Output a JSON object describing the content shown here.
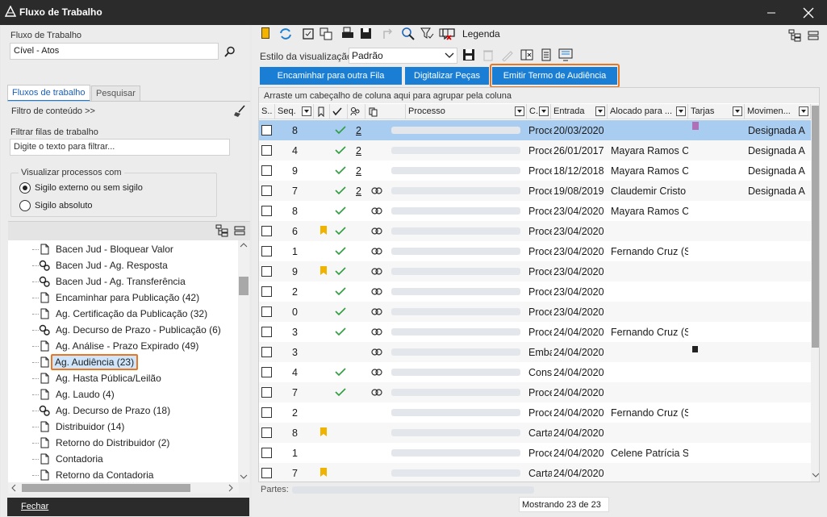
{
  "window": {
    "title": "Fluxo de Trabalho"
  },
  "left": {
    "workflow_label": "Fluxo de Trabalho",
    "workflow_value": "Cível - Atos",
    "tabs": [
      "Fluxos de trabalho",
      "Pesquisar"
    ],
    "content_filter": "Filtro de conteúdo >>",
    "filter_queue_label": "Filtrar filas de trabalho",
    "filter_placeholder": "Digite o texto para filtrar...",
    "visualize_label": "Visualizar processos com",
    "radio_external": "Sigilo externo ou sem sigilo",
    "radio_absolute": "Sigilo absoluto",
    "tree": [
      {
        "label": "Bacen Jud - Bloquear Valor",
        "icon": "doc-icon"
      },
      {
        "label": "Bacen Jud - Ag. Resposta",
        "icon": "gears-icon"
      },
      {
        "label": "Bacen Jud - Ag. Transferência",
        "icon": "gears-icon"
      },
      {
        "label": "Encaminhar para Publicação (42)",
        "icon": "doc-icon"
      },
      {
        "label": "Ag. Certificação da Publicação (32)",
        "icon": "doc-icon"
      },
      {
        "label": "Ag. Decurso de Prazo - Publicação (6)",
        "icon": "gears-icon"
      },
      {
        "label": "Ag. Análise - Prazo Expirado (49)",
        "icon": "doc-icon"
      },
      {
        "label": "Ag. Audiência (23)",
        "icon": "doc-icon"
      },
      {
        "label": "Ag. Hasta Pública/Leilão",
        "icon": "doc-icon"
      },
      {
        "label": "Ag. Laudo (4)",
        "icon": "doc-icon"
      },
      {
        "label": "Ag. Decurso de Prazo (18)",
        "icon": "gears-icon"
      },
      {
        "label": "Distribuidor (14)",
        "icon": "doc-icon"
      },
      {
        "label": "Retorno do Distribuidor (2)",
        "icon": "doc-icon"
      },
      {
        "label": "Contadoria",
        "icon": "doc-icon"
      },
      {
        "label": "Retorno da Contadoria",
        "icon": "doc-icon"
      }
    ],
    "close": "Fechar"
  },
  "toolbar": {
    "legend": "Legenda",
    "view_style_label": "Estilo da visualização",
    "view_style_value": "Padrão"
  },
  "actions": [
    "Encaminhar para outra Fila",
    "Digitalizar Peças",
    "Emitir Termo de Audiência"
  ],
  "grid": {
    "group_hint": "Arraste um cabeçalho de coluna aqui para agrupar pela coluna",
    "columns": [
      "S..",
      "Seq.",
      "",
      "",
      "",
      "",
      "Processo",
      "C..",
      "Entrada",
      "Alocado para ...",
      "Tarjas",
      "Movimen..."
    ],
    "rows": [
      {
        "seq": "8",
        "flag": false,
        "check": true,
        "num": "2",
        "link": false,
        "c": "Proce",
        "entrada": "20/03/2020",
        "alocado": "",
        "tarja": "#b070b8",
        "mov": "Designada A"
      },
      {
        "seq": "4",
        "flag": false,
        "check": true,
        "num": "2",
        "link": false,
        "c": "Proce",
        "entrada": "26/01/2017",
        "alocado": "Mayara Ramos C",
        "tarja": "",
        "mov": "Designada A"
      },
      {
        "seq": "9",
        "flag": false,
        "check": true,
        "num": "2",
        "link": false,
        "c": "Proce",
        "entrada": "18/12/2018",
        "alocado": "Mayara Ramos C",
        "tarja": "",
        "mov": "Designada A"
      },
      {
        "seq": "7",
        "flag": false,
        "check": true,
        "num": "2",
        "link": true,
        "c": "Proce",
        "entrada": "19/08/2019",
        "alocado": "Claudemir Cristo",
        "tarja": "",
        "mov": "Designada A"
      },
      {
        "seq": "8",
        "flag": false,
        "check": true,
        "num": "",
        "link": true,
        "c": "Proce",
        "entrada": "23/04/2020",
        "alocado": "Mayara Ramos C",
        "tarja": "",
        "mov": ""
      },
      {
        "seq": "6",
        "flag": true,
        "check": true,
        "num": "",
        "link": true,
        "c": "Proce",
        "entrada": "23/04/2020",
        "alocado": "",
        "tarja": "",
        "mov": ""
      },
      {
        "seq": "1",
        "flag": false,
        "check": true,
        "num": "",
        "link": true,
        "c": "Proce",
        "entrada": "23/04/2020",
        "alocado": "Fernando Cruz (S",
        "tarja": "",
        "mov": ""
      },
      {
        "seq": "9",
        "flag": true,
        "check": true,
        "num": "",
        "link": true,
        "c": "Proce",
        "entrada": "23/04/2020",
        "alocado": "",
        "tarja": "",
        "mov": ""
      },
      {
        "seq": "2",
        "flag": false,
        "check": true,
        "num": "",
        "link": true,
        "c": "Proce",
        "entrada": "23/04/2020",
        "alocado": "",
        "tarja": "",
        "mov": ""
      },
      {
        "seq": "0",
        "flag": false,
        "check": true,
        "num": "",
        "link": true,
        "c": "Proce",
        "entrada": "23/04/2020",
        "alocado": "",
        "tarja": "",
        "mov": ""
      },
      {
        "seq": "3",
        "flag": false,
        "check": true,
        "num": "",
        "link": true,
        "c": "Proce",
        "entrada": "24/04/2020",
        "alocado": "Fernando Cruz (S",
        "tarja": "",
        "mov": ""
      },
      {
        "seq": "3",
        "flag": false,
        "check": false,
        "num": "",
        "link": true,
        "c": "Emba",
        "entrada": "24/04/2020",
        "alocado": "",
        "tarja": "#222222",
        "mov": ""
      },
      {
        "seq": "4",
        "flag": false,
        "check": true,
        "num": "",
        "link": true,
        "c": "Cons",
        "entrada": "24/04/2020",
        "alocado": "",
        "tarja": "",
        "mov": ""
      },
      {
        "seq": "7",
        "flag": false,
        "check": true,
        "num": "",
        "link": true,
        "c": "Proce",
        "entrada": "24/04/2020",
        "alocado": "",
        "tarja": "",
        "mov": ""
      },
      {
        "seq": "2",
        "flag": false,
        "check": false,
        "num": "",
        "link": false,
        "c": "Proce",
        "entrada": "24/04/2020",
        "alocado": "Fernando Cruz (S",
        "tarja": "",
        "mov": ""
      },
      {
        "seq": "8",
        "flag": true,
        "check": false,
        "num": "",
        "link": false,
        "c": "Carta",
        "entrada": "24/04/2020",
        "alocado": "",
        "tarja": "",
        "mov": ""
      },
      {
        "seq": "1",
        "flag": false,
        "check": false,
        "num": "",
        "link": false,
        "c": "Proce",
        "entrada": "24/04/2020",
        "alocado": "Celene Patrícia S",
        "tarja": "",
        "mov": ""
      },
      {
        "seq": "7",
        "flag": true,
        "check": false,
        "num": "",
        "link": false,
        "c": "Carta",
        "entrada": "24/04/2020",
        "alocado": "",
        "tarja": "",
        "mov": ""
      }
    ]
  },
  "status": {
    "parts_label": "Partes:",
    "count": "Mostrando 23 de 23"
  },
  "colors": {
    "accent": "#1a7fd4",
    "highlight": "#e87722",
    "check": "#2e9e3e",
    "flag": "#f0b400"
  }
}
